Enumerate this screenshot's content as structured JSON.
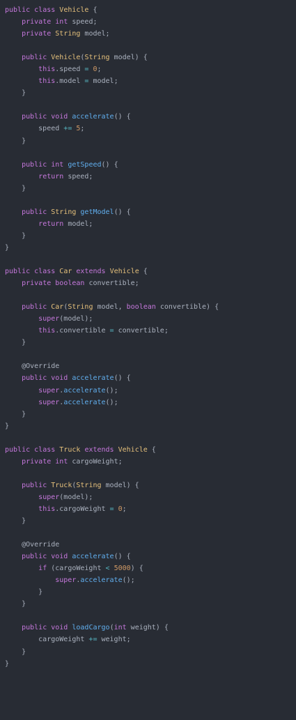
{
  "editor": {
    "language": "java",
    "theme": {
      "background": "#282c34",
      "keyword": "#c678dd",
      "type": "#e5c07b",
      "function": "#61afef",
      "number": "#d19a66",
      "operator": "#56b6c2",
      "text": "#abb2bf"
    },
    "lines": [
      [
        [
          "kw",
          "public"
        ],
        [
          "plain",
          " "
        ],
        [
          "kw",
          "class"
        ],
        [
          "plain",
          " "
        ],
        [
          "type",
          "Vehicle"
        ],
        [
          "punc",
          " {"
        ]
      ],
      [
        [
          "plain",
          "    "
        ],
        [
          "kw",
          "private"
        ],
        [
          "plain",
          " "
        ],
        [
          "kw",
          "int"
        ],
        [
          "plain",
          " speed;"
        ]
      ],
      [
        [
          "plain",
          "    "
        ],
        [
          "kw",
          "private"
        ],
        [
          "plain",
          " "
        ],
        [
          "type",
          "String"
        ],
        [
          "plain",
          " model;"
        ]
      ],
      [],
      [
        [
          "plain",
          "    "
        ],
        [
          "kw",
          "public"
        ],
        [
          "plain",
          " "
        ],
        [
          "type",
          "Vehicle"
        ],
        [
          "punc",
          "("
        ],
        [
          "type",
          "String"
        ],
        [
          "plain",
          " model) {"
        ]
      ],
      [
        [
          "plain",
          "        "
        ],
        [
          "kw",
          "this"
        ],
        [
          "plain",
          ".speed "
        ],
        [
          "op",
          "="
        ],
        [
          "plain",
          " "
        ],
        [
          "num",
          "0"
        ],
        [
          "plain",
          ";"
        ]
      ],
      [
        [
          "plain",
          "        "
        ],
        [
          "kw",
          "this"
        ],
        [
          "plain",
          ".model "
        ],
        [
          "op",
          "="
        ],
        [
          "plain",
          " model;"
        ]
      ],
      [
        [
          "plain",
          "    }"
        ]
      ],
      [],
      [
        [
          "plain",
          "    "
        ],
        [
          "kw",
          "public"
        ],
        [
          "plain",
          " "
        ],
        [
          "kw",
          "void"
        ],
        [
          "plain",
          " "
        ],
        [
          "fn",
          "accelerate"
        ],
        [
          "plain",
          "() {"
        ]
      ],
      [
        [
          "plain",
          "        speed "
        ],
        [
          "op",
          "+="
        ],
        [
          "plain",
          " "
        ],
        [
          "num",
          "5"
        ],
        [
          "plain",
          ";"
        ]
      ],
      [
        [
          "plain",
          "    }"
        ]
      ],
      [],
      [
        [
          "plain",
          "    "
        ],
        [
          "kw",
          "public"
        ],
        [
          "plain",
          " "
        ],
        [
          "kw",
          "int"
        ],
        [
          "plain",
          " "
        ],
        [
          "fn",
          "getSpeed"
        ],
        [
          "plain",
          "() {"
        ]
      ],
      [
        [
          "plain",
          "        "
        ],
        [
          "kw",
          "return"
        ],
        [
          "plain",
          " speed;"
        ]
      ],
      [
        [
          "plain",
          "    }"
        ]
      ],
      [],
      [
        [
          "plain",
          "    "
        ],
        [
          "kw",
          "public"
        ],
        [
          "plain",
          " "
        ],
        [
          "type",
          "String"
        ],
        [
          "plain",
          " "
        ],
        [
          "fn",
          "getModel"
        ],
        [
          "plain",
          "() {"
        ]
      ],
      [
        [
          "plain",
          "        "
        ],
        [
          "kw",
          "return"
        ],
        [
          "plain",
          " model;"
        ]
      ],
      [
        [
          "plain",
          "    }"
        ]
      ],
      [
        [
          "plain",
          "}"
        ]
      ],
      [],
      [
        [
          "kw",
          "public"
        ],
        [
          "plain",
          " "
        ],
        [
          "kw",
          "class"
        ],
        [
          "plain",
          " "
        ],
        [
          "type",
          "Car"
        ],
        [
          "plain",
          " "
        ],
        [
          "kw",
          "extends"
        ],
        [
          "plain",
          " "
        ],
        [
          "type",
          "Vehicle"
        ],
        [
          "plain",
          " {"
        ]
      ],
      [
        [
          "plain",
          "    "
        ],
        [
          "kw",
          "private"
        ],
        [
          "plain",
          " "
        ],
        [
          "kw",
          "boolean"
        ],
        [
          "plain",
          " convertible;"
        ]
      ],
      [],
      [
        [
          "plain",
          "    "
        ],
        [
          "kw",
          "public"
        ],
        [
          "plain",
          " "
        ],
        [
          "type",
          "Car"
        ],
        [
          "plain",
          "("
        ],
        [
          "type",
          "String"
        ],
        [
          "plain",
          " model, "
        ],
        [
          "kw",
          "boolean"
        ],
        [
          "plain",
          " convertible) {"
        ]
      ],
      [
        [
          "plain",
          "        "
        ],
        [
          "kw",
          "super"
        ],
        [
          "plain",
          "(model);"
        ]
      ],
      [
        [
          "plain",
          "        "
        ],
        [
          "kw",
          "this"
        ],
        [
          "plain",
          ".convertible "
        ],
        [
          "op",
          "="
        ],
        [
          "plain",
          " convertible;"
        ]
      ],
      [
        [
          "plain",
          "    }"
        ]
      ],
      [],
      [
        [
          "plain",
          "    "
        ],
        [
          "ann",
          "@Override"
        ]
      ],
      [
        [
          "plain",
          "    "
        ],
        [
          "kw",
          "public"
        ],
        [
          "plain",
          " "
        ],
        [
          "kw",
          "void"
        ],
        [
          "plain",
          " "
        ],
        [
          "fn",
          "accelerate"
        ],
        [
          "plain",
          "() {"
        ]
      ],
      [
        [
          "plain",
          "        "
        ],
        [
          "kw",
          "super"
        ],
        [
          "plain",
          "."
        ],
        [
          "fn",
          "accelerate"
        ],
        [
          "plain",
          "();"
        ]
      ],
      [
        [
          "plain",
          "        "
        ],
        [
          "kw",
          "super"
        ],
        [
          "plain",
          "."
        ],
        [
          "fn",
          "accelerate"
        ],
        [
          "plain",
          "();"
        ]
      ],
      [
        [
          "plain",
          "    }"
        ]
      ],
      [
        [
          "plain",
          "}"
        ]
      ],
      [],
      [
        [
          "kw",
          "public"
        ],
        [
          "plain",
          " "
        ],
        [
          "kw",
          "class"
        ],
        [
          "plain",
          " "
        ],
        [
          "type",
          "Truck"
        ],
        [
          "plain",
          " "
        ],
        [
          "kw",
          "extends"
        ],
        [
          "plain",
          " "
        ],
        [
          "type",
          "Vehicle"
        ],
        [
          "plain",
          " {"
        ]
      ],
      [
        [
          "plain",
          "    "
        ],
        [
          "kw",
          "private"
        ],
        [
          "plain",
          " "
        ],
        [
          "kw",
          "int"
        ],
        [
          "plain",
          " cargoWeight;"
        ]
      ],
      [],
      [
        [
          "plain",
          "    "
        ],
        [
          "kw",
          "public"
        ],
        [
          "plain",
          " "
        ],
        [
          "type",
          "Truck"
        ],
        [
          "plain",
          "("
        ],
        [
          "type",
          "String"
        ],
        [
          "plain",
          " model) {"
        ]
      ],
      [
        [
          "plain",
          "        "
        ],
        [
          "kw",
          "super"
        ],
        [
          "plain",
          "(model);"
        ]
      ],
      [
        [
          "plain",
          "        "
        ],
        [
          "kw",
          "this"
        ],
        [
          "plain",
          ".cargoWeight "
        ],
        [
          "op",
          "="
        ],
        [
          "plain",
          " "
        ],
        [
          "num",
          "0"
        ],
        [
          "plain",
          ";"
        ]
      ],
      [
        [
          "plain",
          "    }"
        ]
      ],
      [],
      [
        [
          "plain",
          "    "
        ],
        [
          "ann",
          "@Override"
        ]
      ],
      [
        [
          "plain",
          "    "
        ],
        [
          "kw",
          "public"
        ],
        [
          "plain",
          " "
        ],
        [
          "kw",
          "void"
        ],
        [
          "plain",
          " "
        ],
        [
          "fn",
          "accelerate"
        ],
        [
          "plain",
          "() {"
        ]
      ],
      [
        [
          "plain",
          "        "
        ],
        [
          "kw",
          "if"
        ],
        [
          "plain",
          " (cargoWeight "
        ],
        [
          "op",
          "<"
        ],
        [
          "plain",
          " "
        ],
        [
          "num",
          "5000"
        ],
        [
          "plain",
          ") {"
        ]
      ],
      [
        [
          "plain",
          "            "
        ],
        [
          "kw",
          "super"
        ],
        [
          "plain",
          "."
        ],
        [
          "fn",
          "accelerate"
        ],
        [
          "plain",
          "();"
        ]
      ],
      [
        [
          "plain",
          "        }"
        ]
      ],
      [
        [
          "plain",
          "    }"
        ]
      ],
      [],
      [
        [
          "plain",
          "    "
        ],
        [
          "kw",
          "public"
        ],
        [
          "plain",
          " "
        ],
        [
          "kw",
          "void"
        ],
        [
          "plain",
          " "
        ],
        [
          "fn",
          "loadCargo"
        ],
        [
          "plain",
          "("
        ],
        [
          "kw",
          "int"
        ],
        [
          "plain",
          " weight) {"
        ]
      ],
      [
        [
          "plain",
          "        cargoWeight "
        ],
        [
          "op",
          "+="
        ],
        [
          "plain",
          " weight;"
        ]
      ],
      [
        [
          "plain",
          "    }"
        ]
      ],
      [
        [
          "plain",
          "}"
        ]
      ]
    ]
  }
}
